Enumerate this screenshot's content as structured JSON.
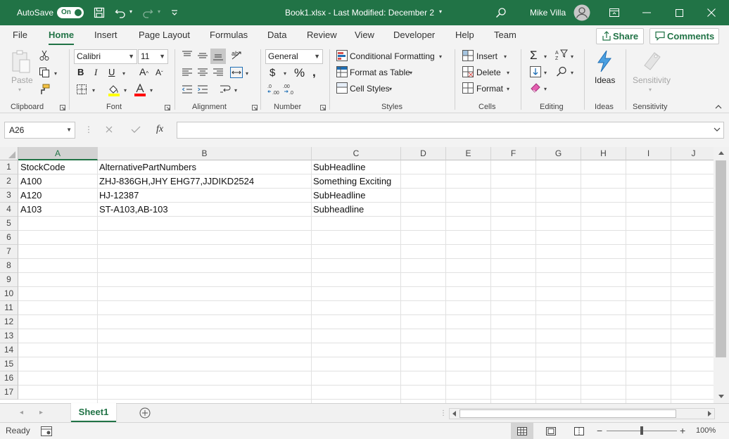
{
  "titlebar": {
    "autosave_label": "AutoSave",
    "autosave_state": "On",
    "doc_title": "Book1.xlsx  -  Last Modified: December 2",
    "user_name": "Mike Villa"
  },
  "tabs": [
    "File",
    "Home",
    "Insert",
    "Page Layout",
    "Formulas",
    "Data",
    "Review",
    "View",
    "Developer",
    "Help",
    "Team"
  ],
  "active_tab": "Home",
  "share_label": "Share",
  "comments_label": "Comments",
  "ribbon": {
    "clipboard": {
      "paste": "Paste",
      "group": "Clipboard"
    },
    "font": {
      "name": "Calibri",
      "size": "11",
      "group": "Font",
      "fill_color": "#ffff00",
      "font_color": "#ff0000"
    },
    "alignment": {
      "group": "Alignment"
    },
    "number": {
      "format": "General",
      "group": "Number"
    },
    "styles": {
      "conditional": "Conditional Formatting",
      "format_table": "Format as Table",
      "cell_styles": "Cell Styles",
      "group": "Styles"
    },
    "cells": {
      "insert": "Insert",
      "delete": "Delete",
      "format": "Format",
      "group": "Cells"
    },
    "editing": {
      "group": "Editing"
    },
    "ideas": {
      "label": "Ideas",
      "group": "Ideas"
    },
    "sensitivity": {
      "label": "Sensitivity",
      "group": "Sensitivity"
    }
  },
  "formula_bar": {
    "name_box": "A26",
    "formula": ""
  },
  "grid": {
    "columns": [
      "A",
      "B",
      "C",
      "D",
      "E",
      "F",
      "G",
      "H",
      "I",
      "J"
    ],
    "rows": [
      "1",
      "2",
      "3",
      "4",
      "5",
      "6",
      "7",
      "8",
      "9",
      "10",
      "11",
      "12",
      "13",
      "14",
      "15",
      "16",
      "17"
    ],
    "data": [
      [
        "StockCode",
        "AlternativePartNumbers",
        "SubHeadline"
      ],
      [
        "A100",
        "ZHJ-836GH,JHY EHG77,JJDIKD2524",
        "Something Exciting"
      ],
      [
        "A120",
        "HJ-12387",
        "SubHeadline"
      ],
      [
        "A103",
        "ST-A103,AB-103",
        "Subheadline"
      ]
    ]
  },
  "sheet_tab": "Sheet1",
  "status": {
    "ready": "Ready",
    "zoom": "100%"
  },
  "colors": {
    "accent": "#217346"
  }
}
